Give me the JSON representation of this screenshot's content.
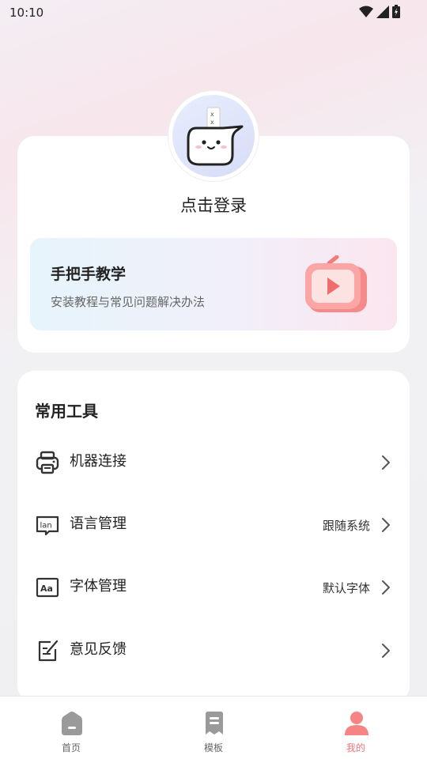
{
  "status_bar": {
    "time": "10:10"
  },
  "profile": {
    "login_label": "点击登录"
  },
  "tutorial": {
    "title": "手把手教学",
    "subtitle": "安装教程与常见问题解决办法"
  },
  "tools": {
    "title": "常用工具",
    "items": [
      {
        "label": "机器连接",
        "value": "",
        "icon": "printer-icon"
      },
      {
        "label": "语言管理",
        "value": "跟随系统",
        "icon": "language-icon"
      },
      {
        "label": "字体管理",
        "value": "默认字体",
        "icon": "font-icon"
      },
      {
        "label": "意见反馈",
        "value": "",
        "icon": "feedback-icon"
      }
    ]
  },
  "tabs": [
    {
      "label": "首页",
      "icon": "home-icon",
      "active": false
    },
    {
      "label": "模板",
      "icon": "template-icon",
      "active": false
    },
    {
      "label": "我的",
      "icon": "profile-icon",
      "active": true
    }
  ],
  "colors": {
    "accent": "#f07676",
    "icon_gray": "#9a9a9a"
  }
}
